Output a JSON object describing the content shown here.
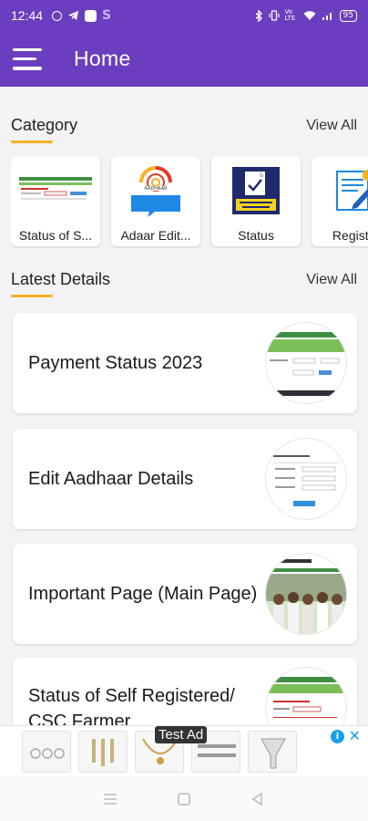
{
  "status_bar": {
    "time": "12:44",
    "battery": "95",
    "signal_text": "Vo LTE"
  },
  "app_bar": {
    "title": "Home",
    "menu_icon": "hamburger-menu-icon"
  },
  "category": {
    "title": "Category",
    "view_all": "View All",
    "items": [
      {
        "label": "Status of S...",
        "icon": "form-screenshot"
      },
      {
        "label": "Adaar Edit...",
        "icon": "aadhaar-logo"
      },
      {
        "label": "Status",
        "icon": "application-status-check"
      },
      {
        "label": "Registra",
        "icon": "registration-form"
      }
    ]
  },
  "latest": {
    "title": "Latest Details",
    "view_all": "View All",
    "items": [
      {
        "title": "Payment Status 2023",
        "thumb": "payment-status-page"
      },
      {
        "title": "Edit Aadhaar Details",
        "thumb": "edit-aadhaar-form"
      },
      {
        "title": "Important Page (Main Page)",
        "thumb": "farmers-group-photo"
      },
      {
        "title": "Status of Self Registered/ CSC Farmer",
        "thumb": "farmer-status-form"
      }
    ]
  },
  "ad": {
    "label": "Test Ad",
    "info": "i",
    "close": "✕"
  },
  "colors": {
    "primary": "#6a3ebe",
    "accent": "#f6b11f"
  }
}
